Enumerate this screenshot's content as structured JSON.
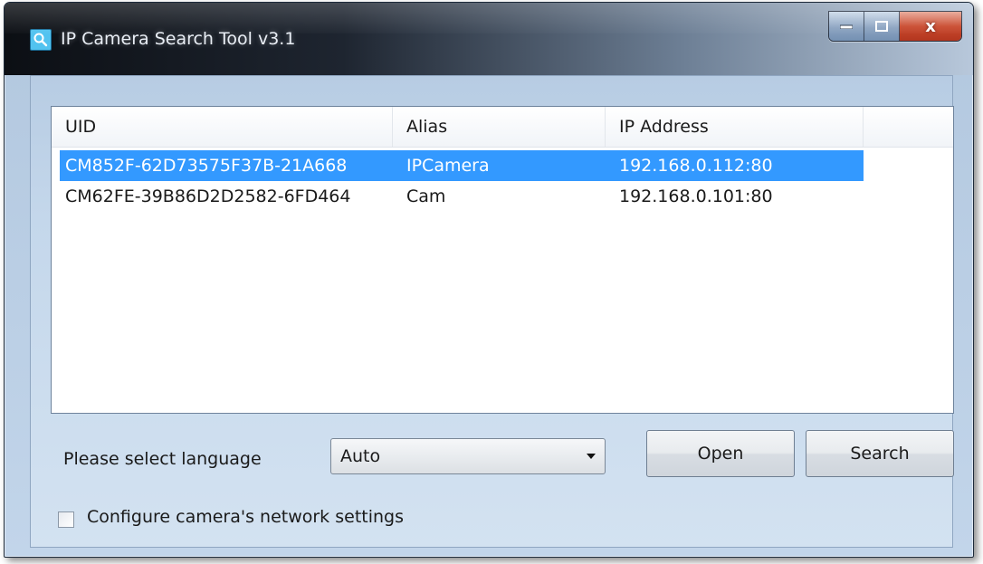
{
  "window": {
    "title": "IP Camera Search Tool  v3.1"
  },
  "caption": {
    "close_symbol": "x"
  },
  "list": {
    "columns": [
      "UID",
      "Alias",
      "IP Address"
    ],
    "rows": [
      {
        "uid": "CM852F-62D73575F37B-21A668",
        "alias": "IPCamera",
        "ip": "192.168.0.112:80",
        "selected": true
      },
      {
        "uid": "CM62FE-39B86D2D2582-6FD464",
        "alias": "Cam",
        "ip": "192.168.0.101:80",
        "selected": false
      }
    ]
  },
  "language": {
    "label": "Please select language",
    "selected": "Auto"
  },
  "buttons": {
    "open": "Open",
    "search": "Search"
  },
  "network": {
    "label": "Configure camera's network settings",
    "checked": false
  },
  "icons": {
    "app": "magnifier-icon",
    "minimize": "minimize-icon",
    "maximize": "maximize-icon",
    "close": "close-icon",
    "dropdown": "chevron-down-icon"
  },
  "colors": {
    "selection": "#3399ff",
    "close_button": "#c9492d"
  }
}
